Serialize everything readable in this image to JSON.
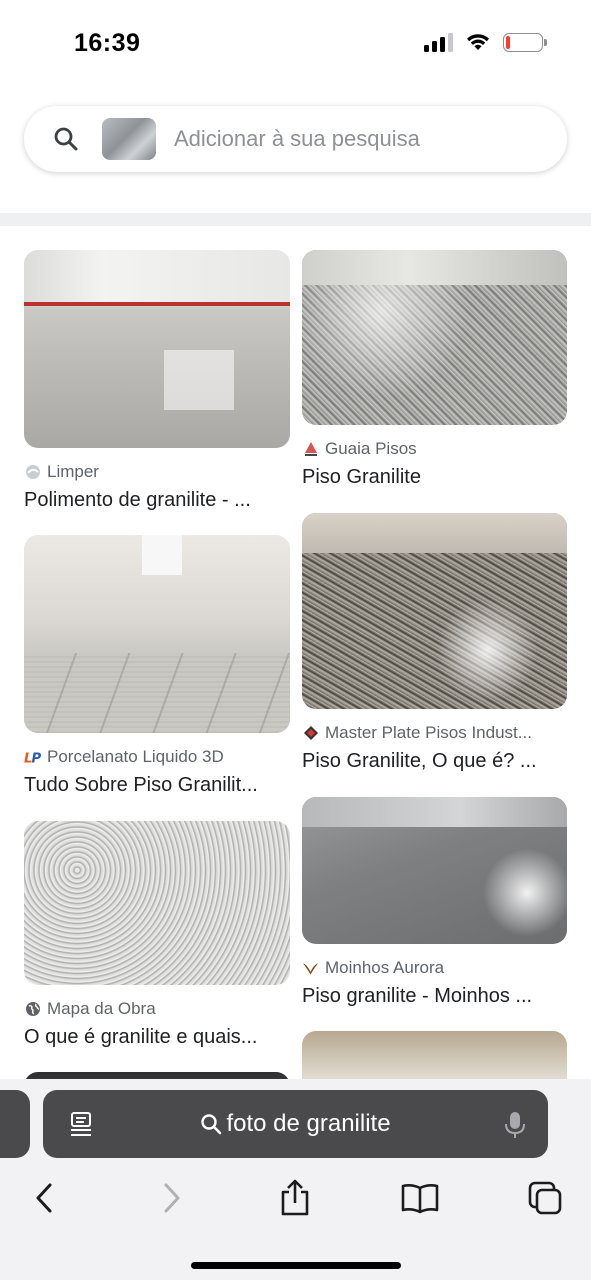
{
  "status_bar": {
    "time": "16:39",
    "icons": [
      "cellular-signal-icon",
      "wifi-icon",
      "battery-low-icon"
    ],
    "battery_color": "#ff3b30",
    "battery_level": 0.12
  },
  "search": {
    "placeholder": "Adicionar à sua pesquisa",
    "icon": "search-icon"
  },
  "results": {
    "left_column": [
      {
        "source": "Limper",
        "source_icon": "site-favicon",
        "title": "Polimento de granilite - ..."
      },
      {
        "source": "Porcelanato Liquido 3D",
        "source_icon": "lp-logo",
        "title": "Tudo Sobre Piso Granilit..."
      },
      {
        "source": "Mapa da Obra",
        "source_icon": "globe-icon",
        "title": "O que é granilite e quais..."
      }
    ],
    "right_column": [
      {
        "source": "Guaia Pisos",
        "source_icon": "site-favicon",
        "title": "Piso Granilite"
      },
      {
        "source": "Master Plate Pisos Indust...",
        "source_icon": "site-favicon",
        "title": "Piso Granilite, O que é? ..."
      },
      {
        "source": "Moinhos Aurora",
        "source_icon": "site-favicon",
        "title": "Piso granilite - Moinhos ..."
      }
    ]
  },
  "address_bar": {
    "query": "foto de granilite"
  },
  "colors": {
    "accent_red": "#ff3b30",
    "address_bar_bg": "#4a4a4c",
    "toolbar_bg": "#f2f2f4"
  }
}
